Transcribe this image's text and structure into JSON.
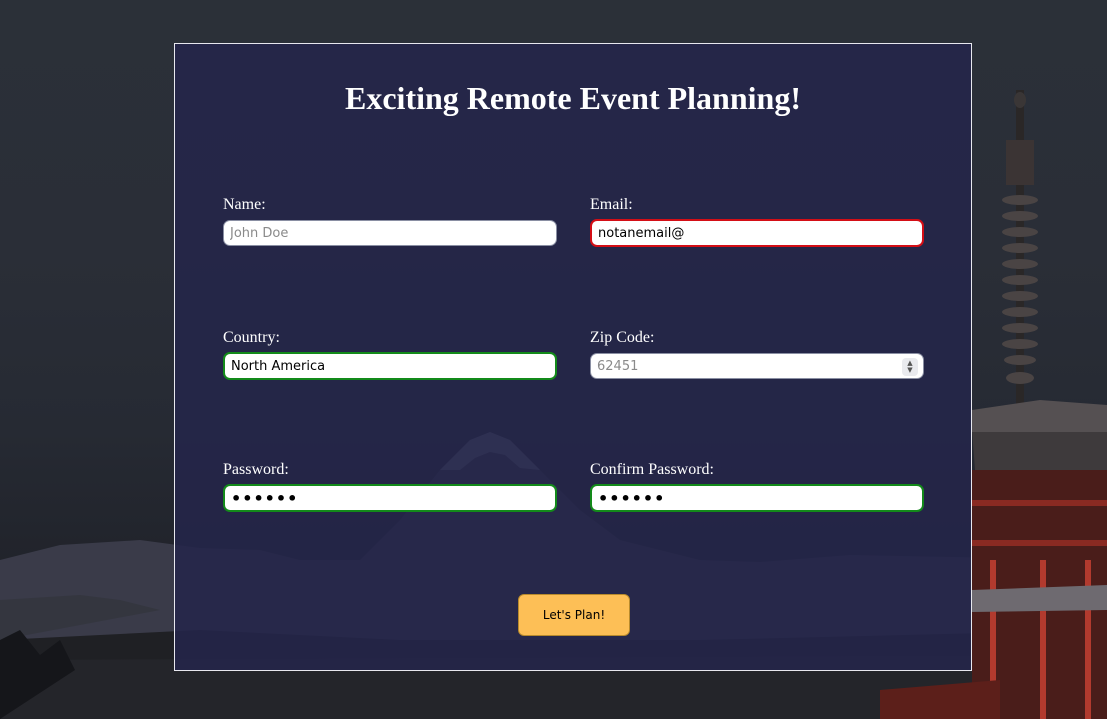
{
  "form": {
    "title": "Exciting Remote Event Planning!",
    "name": {
      "label": "Name:",
      "value": "",
      "placeholder": "John Doe"
    },
    "email": {
      "label": "Email:",
      "value": "notanemail@",
      "placeholder": ""
    },
    "country": {
      "label": "Country:",
      "value": "North America",
      "placeholder": ""
    },
    "zip": {
      "label": "Zip Code:",
      "value": "",
      "placeholder": "62451"
    },
    "password": {
      "label": "Password:",
      "value": "••••••"
    },
    "confirm_password": {
      "label": "Confirm Password:",
      "value": "••••••"
    },
    "submit_label": "Let's Plan!"
  },
  "colors": {
    "card_bg": "#24254a",
    "valid_border": "#138a1a",
    "invalid_border": "#d40e16",
    "button_bg": "#fdbf56"
  },
  "icons": {
    "zip_stepper": "up-down-chevron-icon"
  }
}
